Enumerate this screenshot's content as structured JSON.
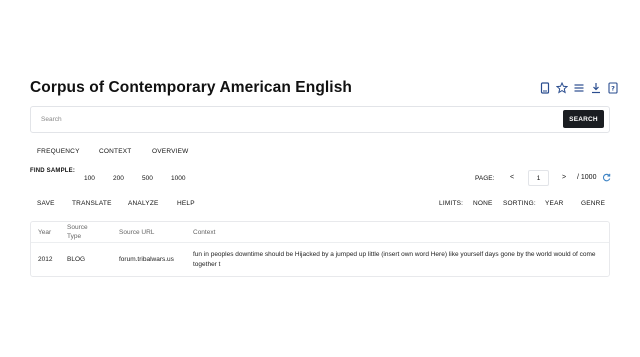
{
  "header": {
    "title": "Corpus of Contemporary American English",
    "icons": [
      "book-icon",
      "star-icon",
      "list-icon",
      "download-icon",
      "help-icon"
    ]
  },
  "search": {
    "placeholder": "Search",
    "value": "",
    "button_label": "SEARCH"
  },
  "tabs": [
    "FREQUENCY",
    "CONTEXT",
    "OVERVIEW"
  ],
  "sample": {
    "label": "FIND SAMPLE:",
    "options": [
      "100",
      "200",
      "500",
      "1000"
    ]
  },
  "pager": {
    "label": "PAGE:",
    "prev": "<",
    "current": "1",
    "next": ">",
    "total": "/ 1000"
  },
  "toolbar": {
    "save": "SAVE",
    "translate": "TRANSLATE",
    "analyze": "ANALYZE",
    "help": "HELP",
    "limits": "LIMITS:",
    "none": "NONE",
    "sorting": "SORTING:",
    "year": "YEAR",
    "genre": "GENRE"
  },
  "table": {
    "headers": [
      "Year",
      "Source Type",
      "Source URL",
      "Context"
    ],
    "rows": [
      {
        "year": "2012",
        "source_type": "BLOG",
        "source_url": "forum.tribalwars.us",
        "context": "fun in peoples downtime should be Hijacked by a jumped up little (insert own word Here) like yourself days gone by the world would of come together t"
      }
    ]
  },
  "colors": {
    "search_button_bg": "#1a1d21",
    "refresh_icon": "#3b82c4",
    "header_icons": "#2a4d8f"
  }
}
